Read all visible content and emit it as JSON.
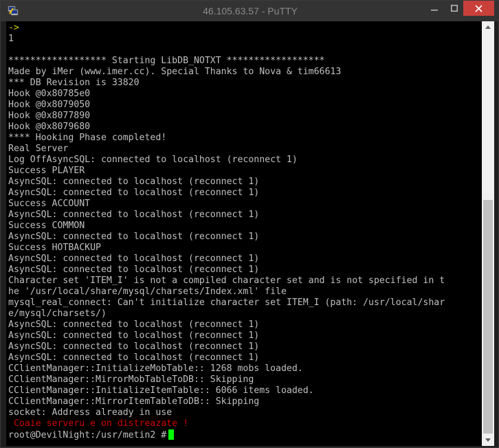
{
  "window": {
    "title": "46.105.63.57 - PuTTY",
    "close_color": "#c9403b",
    "app_icon": "putty-icon"
  },
  "terminal": {
    "lines": [
      {
        "text": "->",
        "color": "yellow"
      },
      {
        "text": "1",
        "color": "default"
      },
      {
        "text": "",
        "color": "default"
      },
      {
        "text": "****************** Starting LibDB_NOTXT ******************",
        "color": "default"
      },
      {
        "text": "Made by iMer (www.imer.cc). Special Thanks to Nova & tim66613",
        "color": "default"
      },
      {
        "text": "*** DB Revision is 33820",
        "color": "default"
      },
      {
        "text": "Hook @0x80785e0",
        "color": "default"
      },
      {
        "text": "Hook @0x8079050",
        "color": "default"
      },
      {
        "text": "Hook @0x8077890",
        "color": "default"
      },
      {
        "text": "Hook @0x8079680",
        "color": "default"
      },
      {
        "text": "**** Hooking Phase completed!",
        "color": "default"
      },
      {
        "text": "Real Server",
        "color": "default"
      },
      {
        "text": "Log OffAsyncSQL: connected to localhost (reconnect 1)",
        "color": "default"
      },
      {
        "text": "Success PLAYER",
        "color": "default"
      },
      {
        "text": "AsyncSQL: connected to localhost (reconnect 1)",
        "color": "default"
      },
      {
        "text": "AsyncSQL: connected to localhost (reconnect 1)",
        "color": "default"
      },
      {
        "text": "Success ACCOUNT",
        "color": "default"
      },
      {
        "text": "AsyncSQL: connected to localhost (reconnect 1)",
        "color": "default"
      },
      {
        "text": "Success COMMON",
        "color": "default"
      },
      {
        "text": "AsyncSQL: connected to localhost (reconnect 1)",
        "color": "default"
      },
      {
        "text": "Success HOTBACKUP",
        "color": "default"
      },
      {
        "text": "AsyncSQL: connected to localhost (reconnect 1)",
        "color": "default"
      },
      {
        "text": "AsyncSQL: connected to localhost (reconnect 1)",
        "color": "default"
      },
      {
        "text": "Character set 'ITEM_I' is not a compiled character set and is not specified in t",
        "color": "default"
      },
      {
        "text": "he '/usr/local/share/mysql/charsets/Index.xml' file",
        "color": "default"
      },
      {
        "text": "mysql_real_connect: Can't initialize character set ITEM_I (path: /usr/local/shar",
        "color": "default"
      },
      {
        "text": "e/mysql/charsets/)",
        "color": "default"
      },
      {
        "text": "AsyncSQL: connected to localhost (reconnect 1)",
        "color": "default"
      },
      {
        "text": "AsyncSQL: connected to localhost (reconnect 1)",
        "color": "default"
      },
      {
        "text": "AsyncSQL: connected to localhost (reconnect 1)",
        "color": "default"
      },
      {
        "text": "AsyncSQL: connected to localhost (reconnect 1)",
        "color": "default"
      },
      {
        "text": "CClientManager::InitializeMobTable:: 1268 mobs loaded.",
        "color": "default"
      },
      {
        "text": "CClientManager::MirrorMobTableToDB:: Skipping",
        "color": "default"
      },
      {
        "text": "CClientManager::InitializeItemTable:: 6066 items loaded.",
        "color": "default"
      },
      {
        "text": "CClientManager::MirrorItemTableToDB:: Skipping",
        "color": "default"
      },
      {
        "text": "socket: Address already in use",
        "color": "default"
      },
      {
        "text": " Coaie serveru e on distreazate !",
        "color": "red"
      }
    ],
    "prompt": "root@DevilNight:/usr/metin2 #",
    "colors": {
      "default": "#c0c0c0",
      "yellow": "#d6d600",
      "red": "#d00000",
      "cursor": "#00ff00",
      "background": "#000000"
    }
  },
  "scrollbar": {
    "up_icon": "scroll-up-arrow-icon",
    "down_icon": "scroll-down-arrow-icon"
  }
}
